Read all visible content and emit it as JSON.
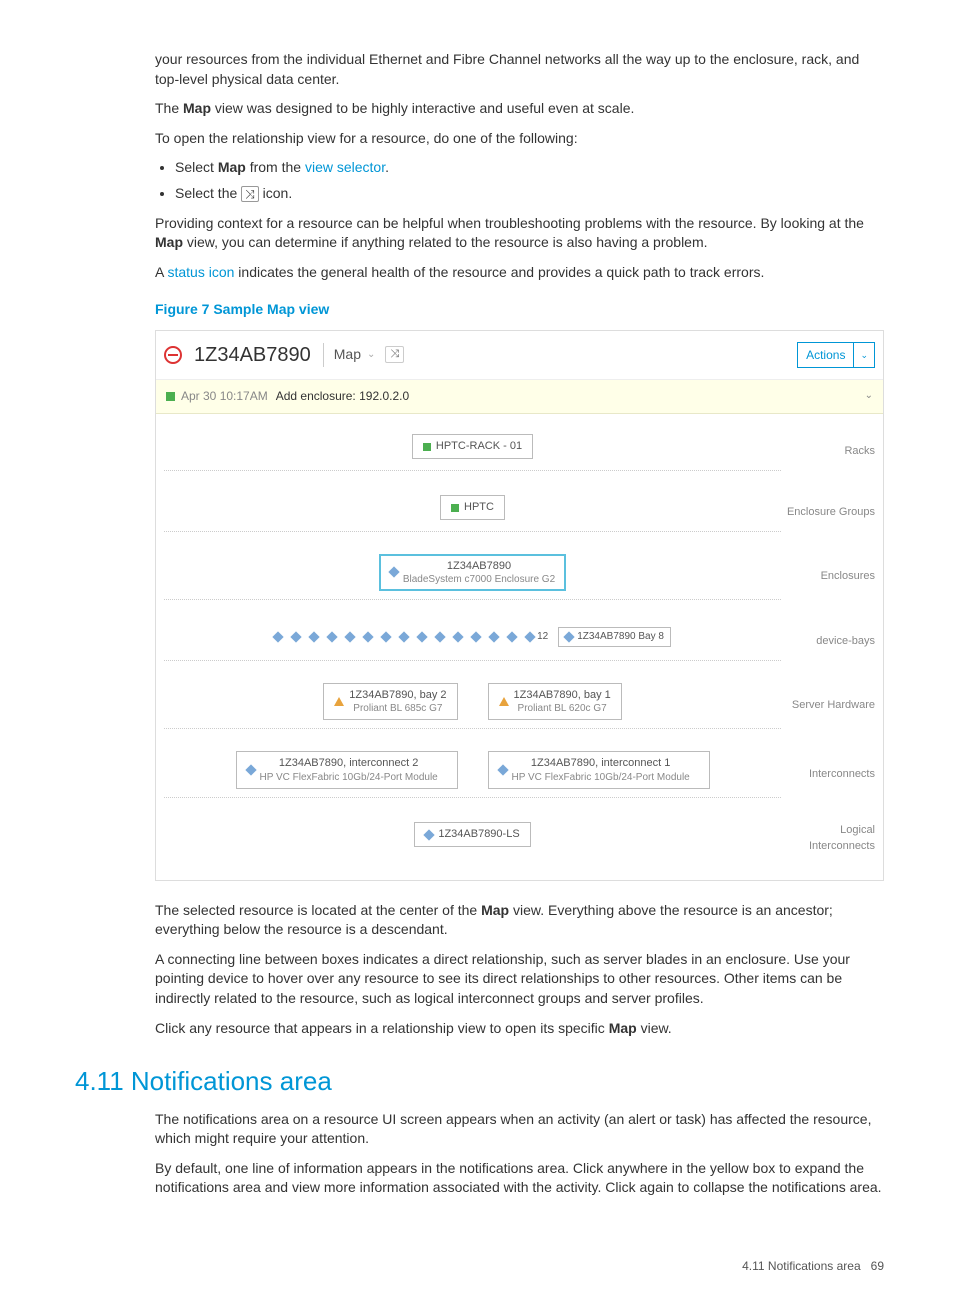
{
  "intro": {
    "p1": "your resources from the individual Ethernet and Fibre Channel networks all the way up to the enclosure, rack, and top-level physical data center.",
    "p2a": "The ",
    "p2b": "Map",
    "p2c": " view was designed to be highly interactive and useful even at scale.",
    "p3": "To open the relationship view for a resource, do one of the following:",
    "li1a": "Select ",
    "li1b": "Map",
    "li1c": " from the ",
    "li1d": "view selector",
    "li1e": ".",
    "li2a": "Select the ",
    "li2b": " icon.",
    "p4a": "Providing context for a resource can be helpful when troubleshooting problems with the resource. By looking at the ",
    "p4b": "Map",
    "p4c": " view, you can determine if anything related to the resource is also having a problem.",
    "p5a": "A ",
    "p5b": "status icon",
    "p5c": " indicates the general health of the resource and provides a quick path to track errors."
  },
  "figcaption": "Figure 7 Sample Map view",
  "figure": {
    "title": "1Z34AB7890",
    "picker": "Map",
    "actions": "Actions",
    "notif_time": "Apr 30 10:17AM",
    "notif_msg": "Add enclosure: 192.0.2.0",
    "rows": {
      "racks": {
        "label": "Racks",
        "node": "HPTC-RACK - 01"
      },
      "encgroups": {
        "label": "Enclosure Groups",
        "node": "HPTC"
      },
      "enclosures": {
        "label": "Enclosures",
        "line1": "1Z34AB7890",
        "line2": "BladeSystem c7000 Enclosure G2"
      },
      "devicebays": {
        "label": "device-bays",
        "count": "12",
        "last": "1Z34AB7890 Bay 8"
      },
      "serverhw": {
        "label": "Server Hardware",
        "left1": "1Z34AB7890, bay 2",
        "left2": "Proliant BL 685c G7",
        "right1": "1Z34AB7890, bay 1",
        "right2": "Proliant BL 620c G7"
      },
      "interconnects": {
        "label": "Interconnects",
        "left1": "1Z34AB7890, interconnect 2",
        "left2": "HP VC FlexFabric 10Gb/24-Port Module",
        "right1": "1Z34AB7890, interconnect 1",
        "right2": "HP VC FlexFabric 10Gb/24-Port Module"
      },
      "logical": {
        "label": "Logical Interconnects",
        "node": "1Z34AB7890-LS"
      }
    }
  },
  "after": {
    "p1a": "The selected resource is located at the center of the ",
    "p1b": "Map",
    "p1c": " view. Everything above the resource is an ancestor; everything below the resource is a descendant.",
    "p2": "A connecting line between boxes indicates a direct relationship, such as server blades in an enclosure. Use your pointing device to hover over any resource to see its direct relationships to other resources. Other items can be indirectly related to the resource, such as logical interconnect groups and server profiles.",
    "p3a": "Click any resource that appears in a relationship view to open its specific ",
    "p3b": "Map",
    "p3c": " view."
  },
  "section": {
    "heading": "4.11 Notifications area",
    "p1": "The notifications area on a resource UI screen appears when an activity (an alert or task) has affected the resource, which might require your attention.",
    "p2": "By default, one line of information appears in the notifications area. Click anywhere in the yellow box to expand the notifications area and view more information associated with the activity. Click again to collapse the notifications area."
  },
  "footer": {
    "text": "4.11 Notifications area",
    "page": "69"
  }
}
